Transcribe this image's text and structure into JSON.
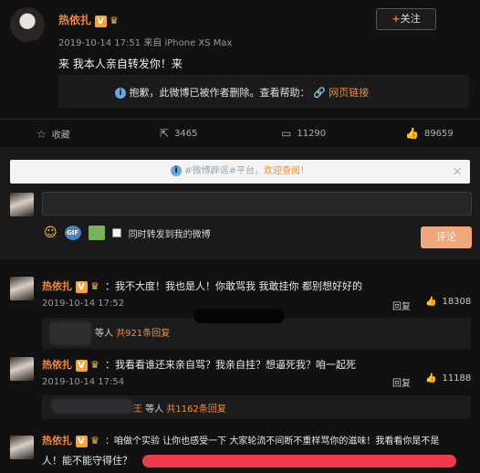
{
  "post": {
    "author": "热依扎",
    "follow_label": "关注",
    "timestamp": "2019-10-14 17:51",
    "source": "来自 iPhone XS Max",
    "text": "来 我本人亲自转发你！来",
    "deleted_notice": "抱歉，此微博已被作者删除。查看帮助：",
    "help_link": "网页链接"
  },
  "actions": {
    "favorite": "收藏",
    "repost": "3465",
    "comments": "11290",
    "likes": "89659"
  },
  "compose": {
    "rumor_text": "#微博辟谣#平台，",
    "rumor_link": "欢迎查阅！",
    "forward_label": "同时转发到我的微博",
    "submit_label": "评论"
  },
  "comments": [
    {
      "author": "热依扎",
      "text": "：我不大度！我也是人！你敢骂我 我敢挂你 都别想好好的",
      "time": "2019-10-14 17:52",
      "reply": "回复",
      "likes": "18308",
      "sub_tail": "等人",
      "sub_more": "共921条回复"
    },
    {
      "author": "热依扎",
      "text": "：我看看谁还来亲自骂？我亲自挂？想逼死我？咱一起死",
      "time": "2019-10-14 17:54",
      "reply": "回复",
      "likes": "11188",
      "sub_prefix": "王",
      "sub_tail": "等人",
      "sub_more": "共1162条回复"
    },
    {
      "author": "热依扎",
      "text_line1": "：咱做个实验 让你也感受一下 大家轮流不间断不重样骂你的滋味！我看看你是不是",
      "text_line2": "人！能不能守得住？"
    }
  ]
}
